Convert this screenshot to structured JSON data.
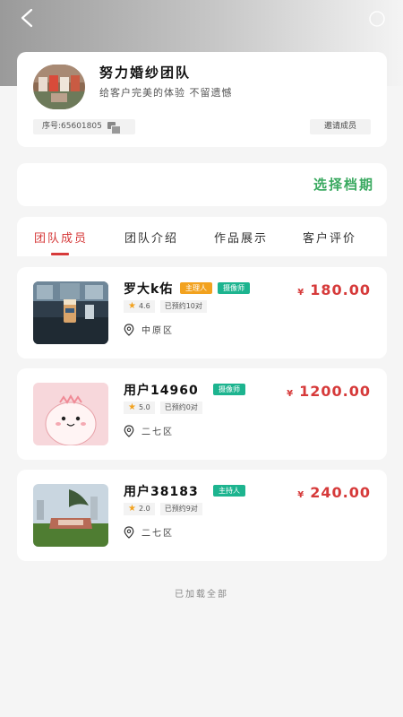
{
  "team": {
    "name": "努力婚纱团队",
    "slogan": "给客户完美的体验 不留遗憾",
    "id_text": "序号:65601805",
    "invite_label": "邀请成员"
  },
  "schedule": {
    "label": "选择档期"
  },
  "tabs": [
    {
      "label": "团队成员",
      "active": true
    },
    {
      "label": "团队介绍",
      "active": false
    },
    {
      "label": "作品展示",
      "active": false
    },
    {
      "label": "客户评价",
      "active": false
    }
  ],
  "members": [
    {
      "name": "罗大k佑",
      "tags": [
        {
          "label": "主理人",
          "color": "#f2a21f"
        },
        {
          "label": "摄像师",
          "color": "#1db48f"
        }
      ],
      "rating": "4.6",
      "booked": "已预约10对",
      "location": "中原区",
      "currency": "¥",
      "price": "180.00"
    },
    {
      "name": "用户14960",
      "tags": [
        {
          "label": "摄像师",
          "color": "#1db48f"
        }
      ],
      "rating": "5.0",
      "booked": "已预约0对",
      "location": "二七区",
      "currency": "¥",
      "price": "1200.00"
    },
    {
      "name": "用户38183",
      "tags": [
        {
          "label": "主持人",
          "color": "#1db48f"
        }
      ],
      "rating": "2.0",
      "booked": "已预约9对",
      "location": "二七区",
      "currency": "¥",
      "price": "240.00"
    }
  ],
  "footer": {
    "text": "已加载全部"
  },
  "colors": {
    "accent_red": "#d63a3a",
    "accent_green": "#3aa960",
    "tag_orange": "#f2a21f",
    "tag_teal": "#1db48f"
  }
}
